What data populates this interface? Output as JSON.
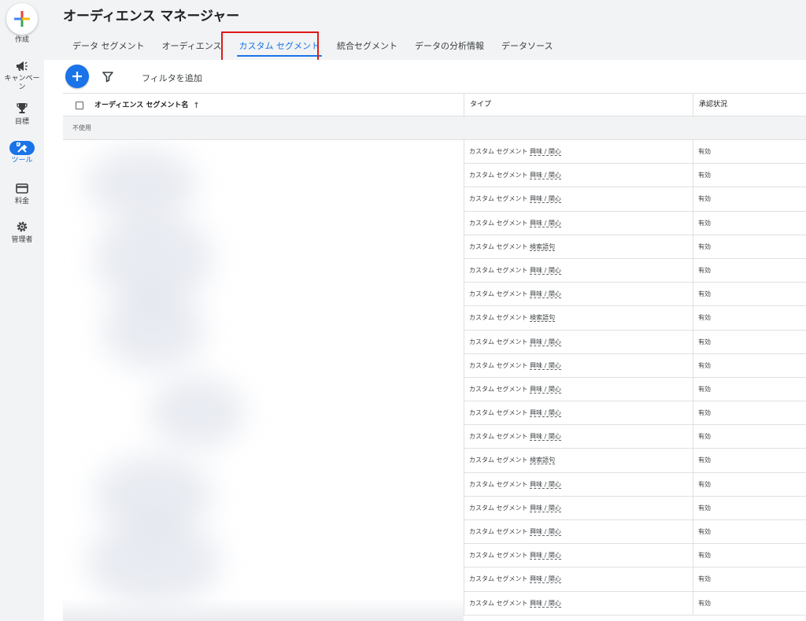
{
  "nav": {
    "create_label": "作成",
    "items": [
      {
        "id": "campaigns",
        "label": "キャンペーン",
        "icon": "megaphone-icon"
      },
      {
        "id": "goals",
        "label": "目標",
        "icon": "trophy-icon"
      },
      {
        "id": "tools",
        "label": "ツール",
        "icon": "tools-icon"
      },
      {
        "id": "billing",
        "label": "料金",
        "icon": "credit-card-icon"
      },
      {
        "id": "admin",
        "label": "管理者",
        "icon": "gear-icon"
      }
    ]
  },
  "header": {
    "title": "オーディエンス マネージャー",
    "tabs": [
      {
        "label": "データ セグメント"
      },
      {
        "label": "オーディエンス"
      },
      {
        "label": "カスタム セグメント"
      },
      {
        "label": "統合セグメント"
      },
      {
        "label": "データの分析情報"
      },
      {
        "label": "データソース"
      }
    ],
    "active_tab": "カスタム セグメント"
  },
  "toolbar": {
    "filter_add_label": "フィルタを追加"
  },
  "table": {
    "columns": {
      "name": "オーディエンス セグメント名",
      "type": "タイプ",
      "status": "承認状況"
    },
    "group_label": "不使用",
    "rows": [
      {
        "type": "カスタム セグメント",
        "subtype": "興味 / 関心",
        "status": "有効"
      },
      {
        "type": "カスタム セグメント",
        "subtype": "興味 / 関心",
        "status": "有効"
      },
      {
        "type": "カスタム セグメント",
        "subtype": "興味 / 関心",
        "status": "有効"
      },
      {
        "type": "カスタム セグメント",
        "subtype": "興味 / 関心",
        "status": "有効"
      },
      {
        "type": "カスタム セグメント",
        "subtype": "検索語句",
        "status": "有効"
      },
      {
        "type": "カスタム セグメント",
        "subtype": "興味 / 関心",
        "status": "有効"
      },
      {
        "type": "カスタム セグメント",
        "subtype": "興味 / 関心",
        "status": "有効"
      },
      {
        "type": "カスタム セグメント",
        "subtype": "検索語句",
        "status": "有効"
      },
      {
        "type": "カスタム セグメント",
        "subtype": "興味 / 関心",
        "status": "有効"
      },
      {
        "type": "カスタム セグメント",
        "subtype": "興味 / 関心",
        "status": "有効"
      },
      {
        "type": "カスタム セグメント",
        "subtype": "興味 / 関心",
        "status": "有効"
      },
      {
        "type": "カスタム セグメント",
        "subtype": "興味 / 関心",
        "status": "有効"
      },
      {
        "type": "カスタム セグメント",
        "subtype": "興味 / 関心",
        "status": "有効"
      },
      {
        "type": "カスタム セグメント",
        "subtype": "検索語句",
        "status": "有効"
      },
      {
        "type": "カスタム セグメント",
        "subtype": "興味 / 関心",
        "status": "有効"
      },
      {
        "type": "カスタム セグメント",
        "subtype": "興味 / 関心",
        "status": "有効"
      },
      {
        "type": "カスタム セグメント",
        "subtype": "興味 / 関心",
        "status": "有効"
      },
      {
        "type": "カスタム セグメント",
        "subtype": "興味 / 関心",
        "status": "有効"
      },
      {
        "type": "カスタム セグメント",
        "subtype": "興味 / 関心",
        "status": "有効"
      },
      {
        "type": "カスタム セグメント",
        "subtype": "興味 / 関心",
        "status": "有効"
      }
    ]
  },
  "colors": {
    "accent": "#1a73e8",
    "highlight": "#e01919",
    "rail_bg": "#f1f3f4"
  }
}
